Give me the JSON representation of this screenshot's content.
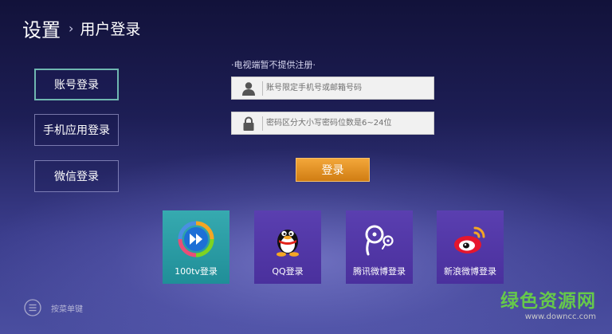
{
  "header": {
    "title": "设置",
    "chevron": "›",
    "subtitle": "用户登录"
  },
  "tabs": [
    {
      "label": "账号登录",
      "active": true
    },
    {
      "label": "手机应用登录",
      "active": false
    },
    {
      "label": "微信登录",
      "active": false
    }
  ],
  "form": {
    "notice": "·电视端暂不提供注册·",
    "account_placeholder": "账号限定手机号或邮箱号码",
    "account_value": "",
    "password_placeholder": "密码区分大小写密码位数是6~24位",
    "password_value": "",
    "login_label": "登录"
  },
  "providers": [
    {
      "label": "100tv登录",
      "icon": "100tv-logo-icon"
    },
    {
      "label": "QQ登录",
      "icon": "qq-penguin-icon"
    },
    {
      "label": "腾讯微博登录",
      "icon": "tencent-weibo-icon"
    },
    {
      "label": "新浪微博登录",
      "icon": "sina-weibo-icon"
    }
  ],
  "menu_hint": {
    "text": "按菜单键",
    "icon": "menu-icon"
  },
  "watermark": {
    "main": "绿色资源网",
    "sub": "www.downcc.com"
  },
  "colors": {
    "accent_orange": "#e59227",
    "tile_teal": "#2a9ea5",
    "tile_purple": "#5237a8",
    "active_tab_border": "#6fb7b0",
    "watermark_green": "#66c94a"
  }
}
